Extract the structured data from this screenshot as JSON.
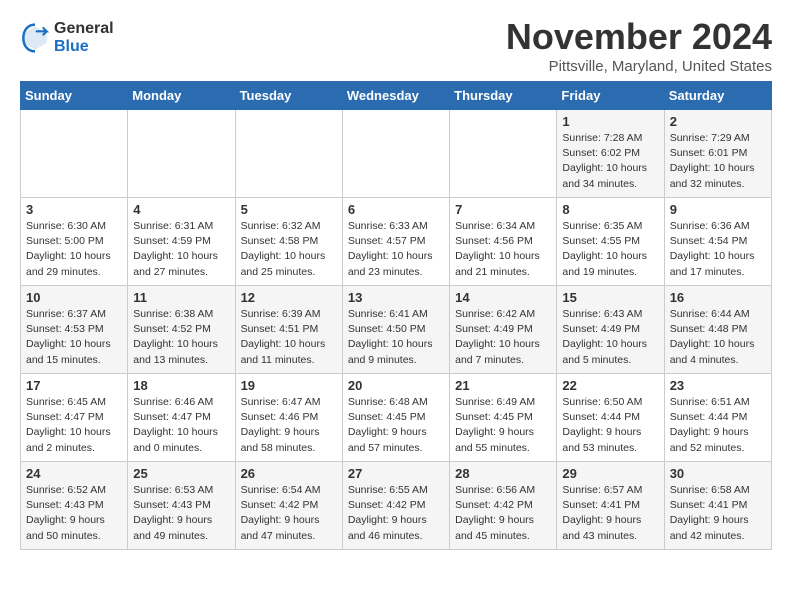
{
  "logo": {
    "general": "General",
    "blue": "Blue"
  },
  "title": "November 2024",
  "location": "Pittsville, Maryland, United States",
  "days_of_week": [
    "Sunday",
    "Monday",
    "Tuesday",
    "Wednesday",
    "Thursday",
    "Friday",
    "Saturday"
  ],
  "weeks": [
    [
      {
        "day": "",
        "info": ""
      },
      {
        "day": "",
        "info": ""
      },
      {
        "day": "",
        "info": ""
      },
      {
        "day": "",
        "info": ""
      },
      {
        "day": "",
        "info": ""
      },
      {
        "day": "1",
        "info": "Sunrise: 7:28 AM\nSunset: 6:02 PM\nDaylight: 10 hours\nand 34 minutes."
      },
      {
        "day": "2",
        "info": "Sunrise: 7:29 AM\nSunset: 6:01 PM\nDaylight: 10 hours\nand 32 minutes."
      }
    ],
    [
      {
        "day": "3",
        "info": "Sunrise: 6:30 AM\nSunset: 5:00 PM\nDaylight: 10 hours\nand 29 minutes."
      },
      {
        "day": "4",
        "info": "Sunrise: 6:31 AM\nSunset: 4:59 PM\nDaylight: 10 hours\nand 27 minutes."
      },
      {
        "day": "5",
        "info": "Sunrise: 6:32 AM\nSunset: 4:58 PM\nDaylight: 10 hours\nand 25 minutes."
      },
      {
        "day": "6",
        "info": "Sunrise: 6:33 AM\nSunset: 4:57 PM\nDaylight: 10 hours\nand 23 minutes."
      },
      {
        "day": "7",
        "info": "Sunrise: 6:34 AM\nSunset: 4:56 PM\nDaylight: 10 hours\nand 21 minutes."
      },
      {
        "day": "8",
        "info": "Sunrise: 6:35 AM\nSunset: 4:55 PM\nDaylight: 10 hours\nand 19 minutes."
      },
      {
        "day": "9",
        "info": "Sunrise: 6:36 AM\nSunset: 4:54 PM\nDaylight: 10 hours\nand 17 minutes."
      }
    ],
    [
      {
        "day": "10",
        "info": "Sunrise: 6:37 AM\nSunset: 4:53 PM\nDaylight: 10 hours\nand 15 minutes."
      },
      {
        "day": "11",
        "info": "Sunrise: 6:38 AM\nSunset: 4:52 PM\nDaylight: 10 hours\nand 13 minutes."
      },
      {
        "day": "12",
        "info": "Sunrise: 6:39 AM\nSunset: 4:51 PM\nDaylight: 10 hours\nand 11 minutes."
      },
      {
        "day": "13",
        "info": "Sunrise: 6:41 AM\nSunset: 4:50 PM\nDaylight: 10 hours\nand 9 minutes."
      },
      {
        "day": "14",
        "info": "Sunrise: 6:42 AM\nSunset: 4:49 PM\nDaylight: 10 hours\nand 7 minutes."
      },
      {
        "day": "15",
        "info": "Sunrise: 6:43 AM\nSunset: 4:49 PM\nDaylight: 10 hours\nand 5 minutes."
      },
      {
        "day": "16",
        "info": "Sunrise: 6:44 AM\nSunset: 4:48 PM\nDaylight: 10 hours\nand 4 minutes."
      }
    ],
    [
      {
        "day": "17",
        "info": "Sunrise: 6:45 AM\nSunset: 4:47 PM\nDaylight: 10 hours\nand 2 minutes."
      },
      {
        "day": "18",
        "info": "Sunrise: 6:46 AM\nSunset: 4:47 PM\nDaylight: 10 hours\nand 0 minutes."
      },
      {
        "day": "19",
        "info": "Sunrise: 6:47 AM\nSunset: 4:46 PM\nDaylight: 9 hours\nand 58 minutes."
      },
      {
        "day": "20",
        "info": "Sunrise: 6:48 AM\nSunset: 4:45 PM\nDaylight: 9 hours\nand 57 minutes."
      },
      {
        "day": "21",
        "info": "Sunrise: 6:49 AM\nSunset: 4:45 PM\nDaylight: 9 hours\nand 55 minutes."
      },
      {
        "day": "22",
        "info": "Sunrise: 6:50 AM\nSunset: 4:44 PM\nDaylight: 9 hours\nand 53 minutes."
      },
      {
        "day": "23",
        "info": "Sunrise: 6:51 AM\nSunset: 4:44 PM\nDaylight: 9 hours\nand 52 minutes."
      }
    ],
    [
      {
        "day": "24",
        "info": "Sunrise: 6:52 AM\nSunset: 4:43 PM\nDaylight: 9 hours\nand 50 minutes."
      },
      {
        "day": "25",
        "info": "Sunrise: 6:53 AM\nSunset: 4:43 PM\nDaylight: 9 hours\nand 49 minutes."
      },
      {
        "day": "26",
        "info": "Sunrise: 6:54 AM\nSunset: 4:42 PM\nDaylight: 9 hours\nand 47 minutes."
      },
      {
        "day": "27",
        "info": "Sunrise: 6:55 AM\nSunset: 4:42 PM\nDaylight: 9 hours\nand 46 minutes."
      },
      {
        "day": "28",
        "info": "Sunrise: 6:56 AM\nSunset: 4:42 PM\nDaylight: 9 hours\nand 45 minutes."
      },
      {
        "day": "29",
        "info": "Sunrise: 6:57 AM\nSunset: 4:41 PM\nDaylight: 9 hours\nand 43 minutes."
      },
      {
        "day": "30",
        "info": "Sunrise: 6:58 AM\nSunset: 4:41 PM\nDaylight: 9 hours\nand 42 minutes."
      }
    ]
  ]
}
